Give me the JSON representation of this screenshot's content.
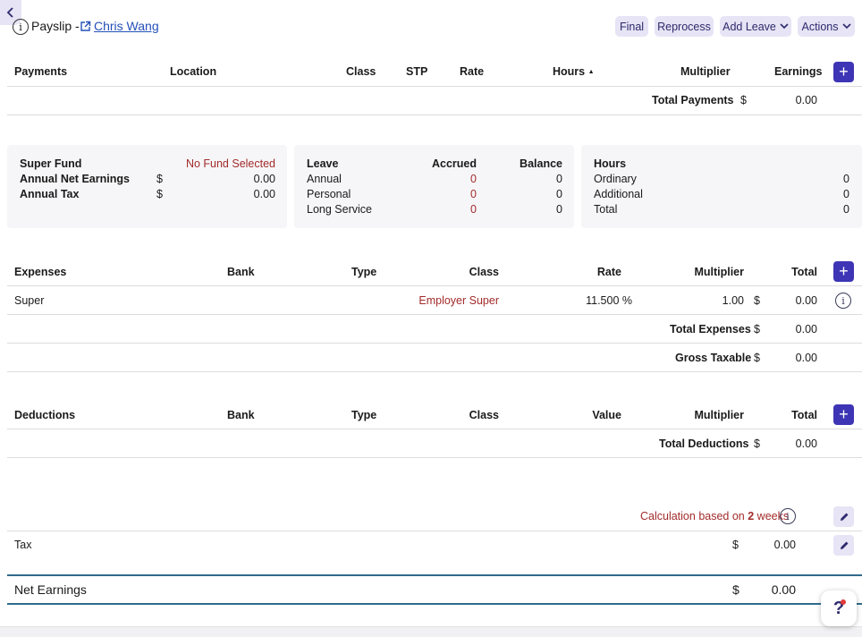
{
  "header": {
    "title": "Payslip -",
    "employee_name": "Chris Wang",
    "buttons": {
      "final": "Final",
      "reprocess": "Reprocess",
      "add_leave": "Add Leave",
      "actions": "Actions"
    }
  },
  "payments": {
    "columns": {
      "payments": "Payments",
      "location": "Location",
      "class": "Class",
      "stp": "STP",
      "rate": "Rate",
      "hours": "Hours",
      "multiplier": "Multiplier",
      "earnings": "Earnings"
    },
    "total_label": "Total Payments",
    "currency": "$",
    "total_value": "0.00"
  },
  "summary": {
    "super_fund_label": "Super Fund",
    "super_fund_value": "No Fund Selected",
    "annual_net_label": "Annual Net Earnings",
    "annual_net_currency": "$",
    "annual_net_value": "0.00",
    "annual_tax_label": "Annual Tax",
    "annual_tax_currency": "$",
    "annual_tax_value": "0.00"
  },
  "leave": {
    "columns": {
      "leave": "Leave",
      "accrued": "Accrued",
      "balance": "Balance"
    },
    "rows": [
      {
        "name": "Annual",
        "accrued": "0",
        "balance": "0"
      },
      {
        "name": "Personal",
        "accrued": "0",
        "balance": "0"
      },
      {
        "name": "Long Service",
        "accrued": "0",
        "balance": "0"
      }
    ]
  },
  "hours_panel": {
    "title": "Hours",
    "rows": [
      {
        "name": "Ordinary",
        "value": "0"
      },
      {
        "name": "Additional",
        "value": "0"
      },
      {
        "name": "Total",
        "value": "0"
      }
    ]
  },
  "expenses": {
    "columns": {
      "expenses": "Expenses",
      "bank": "Bank",
      "type": "Type",
      "class": "Class",
      "rate": "Rate",
      "multiplier": "Multiplier",
      "total": "Total"
    },
    "rows": [
      {
        "name": "Super",
        "class": "Employer Super",
        "rate": "11.500 %",
        "multiplier": "1.00",
        "currency": "$",
        "total": "0.00"
      }
    ],
    "total_label": "Total Expenses",
    "total_currency": "$",
    "total_value": "0.00",
    "gross_label": "Gross Taxable",
    "gross_currency": "$",
    "gross_value": "0.00"
  },
  "deductions": {
    "columns": {
      "deductions": "Deductions",
      "bank": "Bank",
      "type": "Type",
      "class": "Class",
      "value": "Value",
      "multiplier": "Multiplier",
      "total": "Total"
    },
    "total_label": "Total Deductions",
    "total_currency": "$",
    "total_value": "0.00"
  },
  "calculation": {
    "prefix": "Calculation based on",
    "number": "2",
    "unit": "weeks"
  },
  "tax": {
    "label": "Tax",
    "currency": "$",
    "value": "0.00"
  },
  "net": {
    "label": "Net Earnings",
    "currency": "$",
    "value": "0.00"
  },
  "help": {
    "label": "?"
  },
  "colors": {
    "accent": "#3d35b5",
    "button_bg": "#e6e4f5",
    "highlight_red": "#a32b2b",
    "link": "#2450b8"
  },
  "icons": [
    "chevron-left-icon",
    "info-icon",
    "external-link-icon",
    "chevron-down-icon",
    "plus-icon",
    "pencil-icon",
    "help-icon"
  ]
}
